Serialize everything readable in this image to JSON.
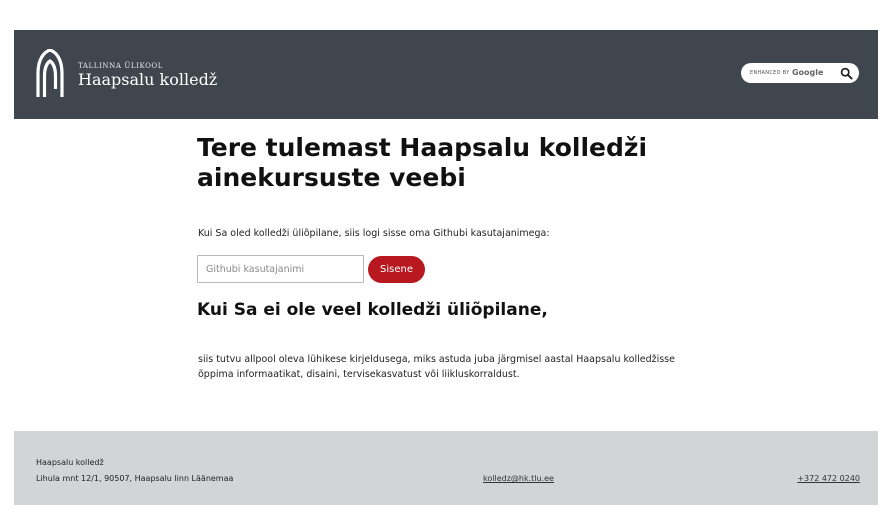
{
  "header": {
    "logo_small": "TALLINNA ÜLIKOOL",
    "logo_big": "Haapsalu kolledž",
    "search": {
      "enhanced_by": "ENHANCED BY",
      "brand": "Google",
      "icon": "search-icon"
    },
    "background_color": "#40464e"
  },
  "main": {
    "title": "Tere tulemast Haapsalu kolledži ainekursuste veebi",
    "intro": "Kui Sa oled kolledži üliõpilane, siis logi sisse oma Githubi kasutajanimega:",
    "username_input": {
      "placeholder": "Githubi kasutajanimi",
      "value": ""
    },
    "login_button": "Sisene",
    "subtitle": "Kui Sa ei ole veel kolledži üliõpilane,",
    "paragraph": "siis tutvu allpool oleva lühikese kirjeldusega, miks astuda juba järgmisel aastal Haapsalu kolledžisse õppima informaatikat, disaini, tervisekasvatust või liikluskorraldust.",
    "accent_color": "#b8181f"
  },
  "footer": {
    "name": "Haapsalu kolledž",
    "address": "Lihula mnt 12/1, 90507, Haapsalu linn Läänemaa",
    "email": "kolledz@hk.tlu.ee",
    "phone": "+372 472 0240",
    "background_color": "#d2d4d6"
  }
}
